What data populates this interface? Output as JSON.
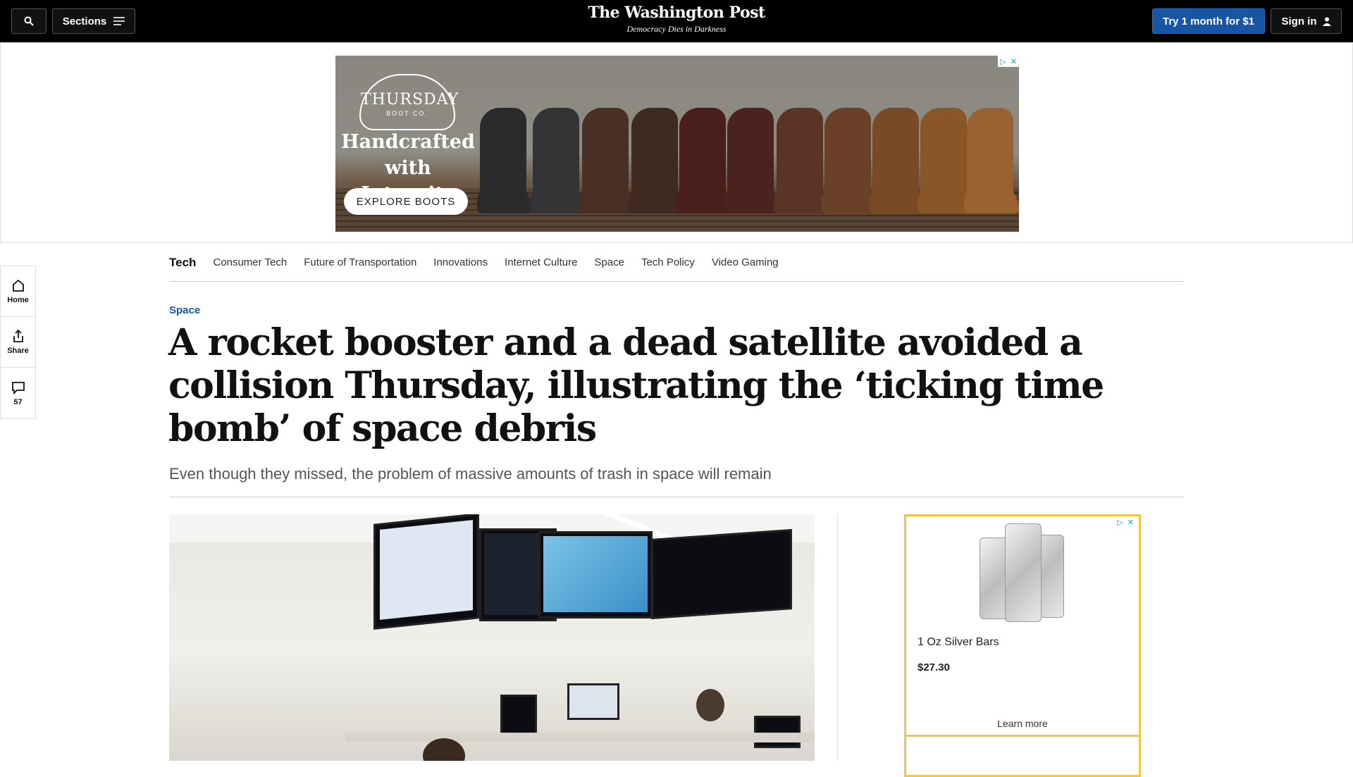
{
  "header": {
    "sections_label": "Sections",
    "logo": "The Washington Post",
    "tagline": "Democracy Dies in Darkness",
    "subscribe_label": "Try 1 month for $1",
    "signin_label": "Sign in"
  },
  "banner_ad": {
    "brand_line1": "THURSDAY",
    "brand_line2": "BOOT CO.",
    "headline": "Handcrafted with Integrity",
    "cta": "EXPLORE BOOTS"
  },
  "rail": {
    "home_label": "Home",
    "share_label": "Share",
    "comments_count": "57"
  },
  "subnav": {
    "section": "Tech",
    "items": [
      "Consumer Tech",
      "Future of Transportation",
      "Innovations",
      "Internet Culture",
      "Space",
      "Tech Policy",
      "Video Gaming"
    ]
  },
  "article": {
    "kicker": "Space",
    "headline": "A rocket booster and a dead satellite avoided a collision Thursday, illustrating the ‘ticking time bomb’ of space debris",
    "dek": "Even though they missed, the problem of massive amounts of trash in space will remain"
  },
  "side_ad": {
    "product_name": "1 Oz Silver Bars",
    "price": "$27.30",
    "cta": "Learn more"
  },
  "colors": {
    "accent": "#1955a5",
    "ad_border": "#f3c547",
    "topbar": "#000000"
  }
}
